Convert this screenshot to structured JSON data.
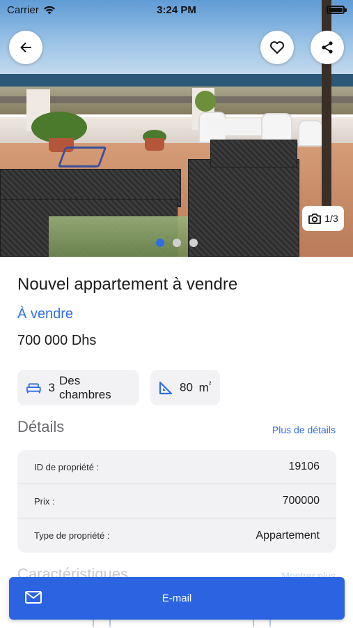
{
  "status_bar": {
    "carrier": "Carrier",
    "time": "3:24 PM"
  },
  "gallery": {
    "counter": "1/3",
    "total_slides": 3,
    "active_slide": 1
  },
  "listing": {
    "title": "Nouvel appartement à vendre",
    "status": "À vendre",
    "price": "700 000 Dhs"
  },
  "features": {
    "bedrooms_count": "3",
    "bedrooms_label": "Des chambres",
    "area_value": "80",
    "area_unit": "m",
    "area_sup": "²"
  },
  "details": {
    "title": "Détails",
    "more_link": "Plus de détails",
    "rows": [
      {
        "label": "ID de propriété :",
        "value": "19106"
      },
      {
        "label": "Prix :",
        "value": "700000"
      },
      {
        "label": "Type de propriété :",
        "value": "Appartement"
      }
    ]
  },
  "next_section": {
    "title": "Caractéristiques",
    "link": "Montrer plus"
  },
  "actions": {
    "email_label": "E-mail"
  },
  "colors": {
    "accent": "#2f6fe4",
    "button": "#2b63e0"
  }
}
